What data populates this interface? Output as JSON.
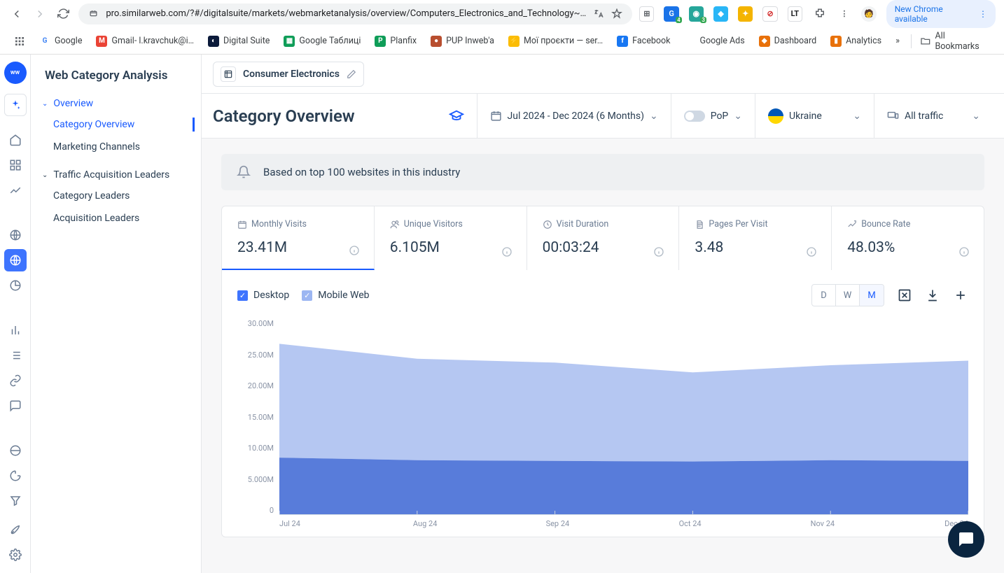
{
  "browser": {
    "url": "pro.similarweb.com/?#/digitalsuite/markets/webmarketanalysis/overview/Computers_Electronics_and_Technology~…",
    "new_chrome": "New Chrome available"
  },
  "bookmarks": [
    {
      "label": "Google",
      "color": "#fff",
      "fg": "#4285f4",
      "initial": "G"
    },
    {
      "label": "Gmail- l.kravchuk@i…",
      "color": "#ea4335",
      "initial": "M"
    },
    {
      "label": "Digital Suite",
      "color": "#0b1a3a",
      "initial": "◐"
    },
    {
      "label": "Google Таблиці",
      "color": "#0f9d58",
      "initial": "▦"
    },
    {
      "label": "Planfix",
      "color": "#0f9d58",
      "initial": "P"
    },
    {
      "label": "PUP Inweb'a",
      "color": "#b84e2f",
      "initial": "●"
    },
    {
      "label": "Мої проєкти — ser…",
      "color": "#fbbc05",
      "initial": "⚡"
    },
    {
      "label": "Facebook",
      "color": "#1877f2",
      "initial": "f"
    },
    {
      "label": "Google Ads",
      "color": "#fff",
      "initial": "▲"
    },
    {
      "label": "Dashboard",
      "color": "#e8710a",
      "initial": "◆"
    },
    {
      "label": "Analytics",
      "color": "#e8710a",
      "initial": "▮"
    }
  ],
  "all_bookmarks": "All Bookmarks",
  "sidebar": {
    "title": "Web Category Analysis",
    "groups": [
      {
        "label": "Overview",
        "open": true,
        "active": true,
        "items": [
          {
            "label": "Category Overview",
            "active": true
          },
          {
            "label": "Marketing Channels"
          }
        ]
      },
      {
        "label": "Traffic Acquisition Leaders",
        "open": true,
        "items": [
          {
            "label": "Category Leaders"
          },
          {
            "label": "Acquisition Leaders"
          }
        ]
      }
    ]
  },
  "context": {
    "chip": "Consumer Electronics"
  },
  "filters": {
    "title": "Category Overview",
    "date_range": "Jul 2024 - Dec 2024 (6 Months)",
    "pop": "PoP",
    "country": "Ukraine",
    "traffic": "All traffic"
  },
  "notice": "Based on top 100 websites in this industry",
  "metrics": [
    {
      "label": "Monthly Visits",
      "value": "23.41M",
      "icon": "calendar",
      "active": true
    },
    {
      "label": "Unique Visitors",
      "value": "6.105M",
      "icon": "users"
    },
    {
      "label": "Visit Duration",
      "value": "00:03:24",
      "icon": "clock"
    },
    {
      "label": "Pages Per Visit",
      "value": "3.48",
      "icon": "pages"
    },
    {
      "label": "Bounce Rate",
      "value": "48.03%",
      "icon": "bounce"
    }
  ],
  "legend": {
    "desktop": "Desktop",
    "mobile": "Mobile Web"
  },
  "granularity": {
    "d": "D",
    "w": "W",
    "m": "M"
  },
  "chart_data": {
    "type": "area",
    "title": "Monthly Visits",
    "xlabel": "",
    "ylabel": "",
    "ylim": [
      0,
      30000000
    ],
    "y_ticks": [
      "30.00M",
      "25.00M",
      "20.00M",
      "15.00M",
      "10.00M",
      "5.000M",
      "0"
    ],
    "categories": [
      "Jul 24",
      "Aug 24",
      "Sep 24",
      "Oct 24",
      "Nov 24",
      "Dec 24"
    ],
    "series": [
      {
        "name": "Desktop",
        "color": "#4f75d8",
        "values": [
          8700000,
          8300000,
          8200000,
          8100000,
          8300000,
          8200000
        ]
      },
      {
        "name": "Mobile Web",
        "color": "#a8bdf0",
        "values": [
          17500000,
          15600000,
          15100000,
          13700000,
          14600000,
          15400000
        ]
      }
    ],
    "stacked_totals": [
      26200000,
      23900000,
      23300000,
      21800000,
      22900000,
      23600000
    ]
  }
}
